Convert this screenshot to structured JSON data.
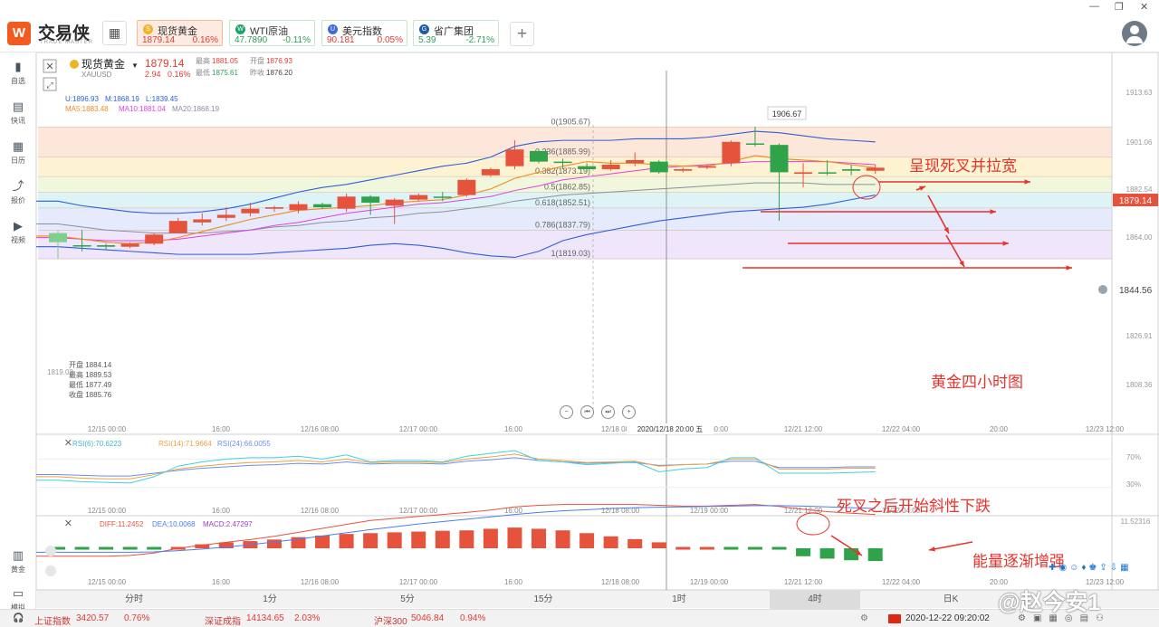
{
  "app": {
    "name": "交易侠",
    "sub": "TRADE MASTER",
    "logo": "W"
  },
  "window": {
    "close": "✕",
    "min": "—",
    "max": "❐"
  },
  "grid_icon": "▦",
  "add_icon": "+",
  "tabs": [
    {
      "name": "现货黄金",
      "price": "1879.14",
      "change": "0.16%",
      "icon": "S",
      "iconColor": "#f0b429",
      "priceColor": "#e53935",
      "changeColor": "#e53935",
      "active": true
    },
    {
      "name": "WTI原油",
      "price": "47.7890",
      "change": "-0.11%",
      "icon": "W",
      "iconColor": "#20a36b",
      "priceColor": "#2e9e58",
      "changeColor": "#2e9e58",
      "active": false
    },
    {
      "name": "美元指数",
      "price": "90.181",
      "change": "0.05%",
      "icon": "U",
      "iconColor": "#3f6bd6",
      "priceColor": "#e53935",
      "changeColor": "#e53935",
      "active": false
    },
    {
      "name": "省广集团",
      "price": "5.39",
      "change": "-2.71%",
      "icon": "G",
      "iconColor": "#1f5aa6",
      "priceColor": "#2e9e58",
      "changeColor": "#2e9e58",
      "active": false
    }
  ],
  "sidebar": [
    {
      "label": "自选",
      "icon": "bookmark-icon",
      "glyph": "▮"
    },
    {
      "label": "快讯",
      "icon": "news-icon",
      "glyph": "▤"
    },
    {
      "label": "日历",
      "icon": "calendar-icon",
      "glyph": "▦"
    },
    {
      "label": "报价",
      "icon": "trend-icon",
      "glyph": "⤴"
    },
    {
      "label": "视频",
      "icon": "play-icon",
      "glyph": "▶"
    },
    {
      "label": "黄金",
      "icon": "gold-icon",
      "glyph": "▥"
    },
    {
      "label": "模拟",
      "icon": "simulate-icon",
      "glyph": "▭"
    }
  ],
  "symbol": {
    "name": "现货黄金",
    "code": "XAUUSD",
    "price": "1879.14",
    "change": "2.94",
    "pct": "0.16%",
    "high_label": "最高",
    "high": "1881.05",
    "open_label": "开盘",
    "open": "1876.93",
    "low_label": "最低",
    "low": "1875.61",
    "prev_label": "昨收",
    "prev": "1876.20"
  },
  "indicators": {
    "boll_u": "U:1896.93",
    "boll_m": "M:1868.19",
    "boll_l": "L:1839.45",
    "ma5": "MA5:1883.48",
    "ma10": "MA10:1881.04",
    "ma20": "MA20:1868.19"
  },
  "fib_labels": [
    "0(1905.67)",
    "0.236(1885.99)",
    "0.382(1873.19)",
    "0.5(1862.85)",
    "0.618(1852.51)",
    "0.786(1837.79)",
    "1(1819.03)"
  ],
  "price_axis": [
    "1913.63",
    "1901.06",
    "1882.54",
    "1864.00",
    "1844.56",
    "1826.91",
    "1808.36"
  ],
  "current_price": "1879.14",
  "alert_price": "1844.56",
  "peak_label": "1906.67",
  "low_label_left": "1819.03",
  "info_box": [
    "开盘 1884.14",
    "最高 1889.53",
    "最低 1877.49",
    "收盘 1885.76"
  ],
  "time_axis": [
    "12/15 00:00",
    "16:00",
    "12/16 08:00",
    "12/17 00:00",
    "16:00",
    "12/18 08:00",
    "12/19 00:00",
    "12/21 12:00",
    "12/22 04:00",
    "20:00",
    "12/23 12:00"
  ],
  "crosshair_time": "2020/12/18 20:00 五",
  "rsi": {
    "r1": "RSI(6):70.6223",
    "r2": "RSI(14):71.9664",
    "r3": "RSI(24):66.0055",
    "l70": "70%",
    "l30": "30%"
  },
  "macd": {
    "diff": "DIFF:11.2452",
    "dea": "DEA:10.0068",
    "macd": "MACD:2.47297",
    "axis_top": "11.52316"
  },
  "annotations": {
    "a1": "呈现死叉并拉宽",
    "a2": "黄金四小时图",
    "a3": "死叉之后开始斜性下跌",
    "a4": "能量逐渐增强"
  },
  "periods": [
    "分时",
    "1分",
    "5分",
    "15分",
    "1时",
    "4时",
    "日K"
  ],
  "active_period": "4时",
  "status": {
    "sh_name": "上证指数",
    "sh_val": "3420.57",
    "sh_pct": "0.76%",
    "sz_name": "深证成指",
    "sz_val": "14134.65",
    "sz_pct": "2.03%",
    "hs_name": "沪深300",
    "hs_val": "5046.84",
    "hs_pct": "0.94%",
    "datetime": "2020-12-22 09:20:02"
  },
  "watermark": "@赵今安1",
  "colors": {
    "up": "#e5533d",
    "down": "#2ea34a",
    "boll": "#2f5fd8",
    "ma5": "#f08a1c",
    "ma10": "#e040e0",
    "ma20": "#8a8fa0",
    "ann": "#e8322b"
  },
  "chart_data": {
    "type": "candlestick",
    "candles": [
      {
        "o": 1830,
        "c": 1836,
        "h": 1838,
        "l": 1819
      },
      {
        "o": 1828,
        "c": 1828,
        "h": 1838,
        "l": 1824
      },
      {
        "o": 1828,
        "c": 1827,
        "h": 1829,
        "l": 1825
      },
      {
        "o": 1827,
        "c": 1829,
        "h": 1830,
        "l": 1826
      },
      {
        "o": 1829,
        "c": 1835,
        "h": 1836,
        "l": 1828
      },
      {
        "o": 1836,
        "c": 1844,
        "h": 1846,
        "l": 1836
      },
      {
        "o": 1843,
        "c": 1845,
        "h": 1849,
        "l": 1841
      },
      {
        "o": 1846,
        "c": 1848,
        "h": 1853,
        "l": 1844
      },
      {
        "o": 1849,
        "c": 1852,
        "h": 1856,
        "l": 1847
      },
      {
        "o": 1852,
        "c": 1853,
        "h": 1854,
        "l": 1850
      },
      {
        "o": 1851,
        "c": 1855,
        "h": 1857,
        "l": 1849
      },
      {
        "o": 1855,
        "c": 1853,
        "h": 1856,
        "l": 1852
      },
      {
        "o": 1852,
        "c": 1860,
        "h": 1862,
        "l": 1850
      },
      {
        "o": 1860,
        "c": 1856,
        "h": 1861,
        "l": 1848
      },
      {
        "o": 1854,
        "c": 1858,
        "h": 1859,
        "l": 1842
      },
      {
        "o": 1858,
        "c": 1861,
        "h": 1862,
        "l": 1857
      },
      {
        "o": 1860,
        "c": 1860,
        "h": 1863,
        "l": 1857
      },
      {
        "o": 1861,
        "c": 1871,
        "h": 1872,
        "l": 1860
      },
      {
        "o": 1874,
        "c": 1878,
        "h": 1879,
        "l": 1873
      },
      {
        "o": 1880,
        "c": 1891,
        "h": 1897,
        "l": 1878
      },
      {
        "o": 1890,
        "c": 1883,
        "h": 1891,
        "l": 1882
      },
      {
        "o": 1883,
        "c": 1883,
        "h": 1885,
        "l": 1878
      },
      {
        "o": 1880,
        "c": 1878,
        "h": 1882,
        "l": 1876
      },
      {
        "o": 1878,
        "c": 1881,
        "h": 1884,
        "l": 1877
      },
      {
        "o": 1882,
        "c": 1884,
        "h": 1889,
        "l": 1880
      },
      {
        "o": 1883,
        "c": 1876,
        "h": 1884,
        "l": 1875
      },
      {
        "o": 1877,
        "c": 1878,
        "h": 1879,
        "l": 1876
      },
      {
        "o": 1879,
        "c": 1880,
        "h": 1881,
        "l": 1878
      },
      {
        "o": 1882,
        "c": 1896,
        "h": 1897,
        "l": 1880
      },
      {
        "o": 1895,
        "c": 1895,
        "h": 1906,
        "l": 1893
      },
      {
        "o": 1894,
        "c": 1876,
        "h": 1895,
        "l": 1844
      },
      {
        "o": 1875,
        "c": 1876,
        "h": 1882,
        "l": 1866
      },
      {
        "o": 1876,
        "c": 1876,
        "h": 1884,
        "l": 1874
      },
      {
        "o": 1878,
        "c": 1877,
        "h": 1881,
        "l": 1874
      },
      {
        "o": 1877,
        "c": 1879,
        "h": 1881,
        "l": 1875
      }
    ],
    "boll_upper": [
      1857,
      1854,
      1852,
      1850,
      1849,
      1849,
      1850,
      1852,
      1855,
      1859,
      1863,
      1866,
      1868,
      1871,
      1874,
      1877,
      1880,
      1882,
      1886,
      1893,
      1896,
      1897,
      1897,
      1897,
      1898,
      1898,
      1898,
      1899,
      1901,
      1903,
      1902,
      1900,
      1898,
      1897,
      1896
    ],
    "boll_lower": [
      1827,
      1826,
      1825,
      1824,
      1823,
      1822,
      1822,
      1822,
      1822,
      1823,
      1824,
      1825,
      1826,
      1828,
      1829,
      1828,
      1826,
      1823,
      1821,
      1820,
      1824,
      1831,
      1835,
      1838,
      1841,
      1844,
      1846,
      1848,
      1850,
      1851,
      1852,
      1853,
      1855,
      1858,
      1861
    ],
    "ma5": [
      1834,
      1832,
      1830,
      1829,
      1830,
      1833,
      1837,
      1841,
      1845,
      1848,
      1851,
      1852,
      1853,
      1854,
      1856,
      1857,
      1858,
      1861,
      1865,
      1872,
      1876,
      1880,
      1883,
      1882,
      1882,
      1881,
      1880,
      1880,
      1883,
      1887,
      1885,
      1884,
      1883,
      1881,
      1879
    ],
    "ma10": [
      1833,
      1832,
      1831,
      1831,
      1831,
      1832,
      1834,
      1836,
      1838,
      1841,
      1843,
      1846,
      1849,
      1851,
      1853,
      1855,
      1856,
      1858,
      1860,
      1864,
      1867,
      1871,
      1873,
      1875,
      1877,
      1879,
      1880,
      1881,
      1882,
      1883,
      1883,
      1883,
      1883,
      1882,
      1881
    ],
    "ma20": [
      1842,
      1840,
      1838,
      1837,
      1836,
      1836,
      1836,
      1837,
      1838,
      1840,
      1841,
      1843,
      1844,
      1846,
      1847,
      1849,
      1850,
      1852,
      1854,
      1857,
      1859,
      1861,
      1862,
      1863,
      1864,
      1865,
      1866,
      1867,
      1868,
      1869,
      1869,
      1869,
      1868,
      1868,
      1868
    ],
    "rsi6": [
      40,
      38,
      37,
      36,
      45,
      60,
      66,
      70,
      72,
      72,
      74,
      70,
      76,
      66,
      68,
      68,
      66,
      74,
      78,
      82,
      68,
      66,
      62,
      64,
      66,
      52,
      56,
      58,
      72,
      72,
      50,
      50,
      50,
      51,
      52
    ],
    "rsi14": [
      45,
      43,
      42,
      42,
      48,
      56,
      60,
      63,
      65,
      66,
      68,
      66,
      70,
      65,
      66,
      66,
      65,
      70,
      73,
      77,
      70,
      68,
      65,
      66,
      67,
      60,
      62,
      63,
      70,
      70,
      56,
      56,
      56,
      57,
      57
    ],
    "rsi24": [
      48,
      47,
      46,
      46,
      50,
      54,
      57,
      59,
      61,
      62,
      64,
      63,
      66,
      63,
      64,
      64,
      63,
      67,
      69,
      72,
      68,
      66,
      64,
      65,
      65,
      61,
      62,
      63,
      67,
      67,
      58,
      58,
      58,
      59,
      59
    ],
    "macd_hist": [
      -1.5,
      -1.5,
      -1.5,
      -1.2,
      -0.8,
      0.5,
      1.0,
      1.5,
      1.8,
      2.2,
      2.8,
      3.2,
      3.6,
      3.8,
      4.0,
      4.2,
      4.4,
      4.5,
      4.9,
      5.2,
      4.9,
      4.5,
      3.8,
      3.0,
      2.3,
      1.5,
      0.8,
      0.3,
      -0.2,
      -0.3,
      -0.4,
      -2.0,
      -2.6,
      -3.0,
      -3.2
    ],
    "macd_diff": [
      -2,
      -2,
      -2,
      -1.8,
      -1.2,
      0,
      0.8,
      1.5,
      2.2,
      3,
      4,
      5,
      6,
      7,
      7.5,
      8,
      8.5,
      9,
      9.6,
      10.4,
      10.8,
      11,
      11,
      11,
      11,
      10.8,
      10.6,
      10.6,
      10.8,
      11,
      10.5,
      9.8,
      9.2,
      8.8,
      8.5
    ],
    "macd_dea": [
      -1,
      -1,
      -1,
      -1,
      -0.9,
      -0.6,
      -0.2,
      0.3,
      0.9,
      1.6,
      2.3,
      3.1,
      3.9,
      4.7,
      5.4,
      6.1,
      6.7,
      7.3,
      7.9,
      8.5,
      9,
      9.4,
      9.7,
      10,
      10.2,
      10.3,
      10.4,
      10.5,
      10.6,
      10.7,
      10.7,
      10.6,
      10.4,
      10.2,
      10
    ]
  }
}
